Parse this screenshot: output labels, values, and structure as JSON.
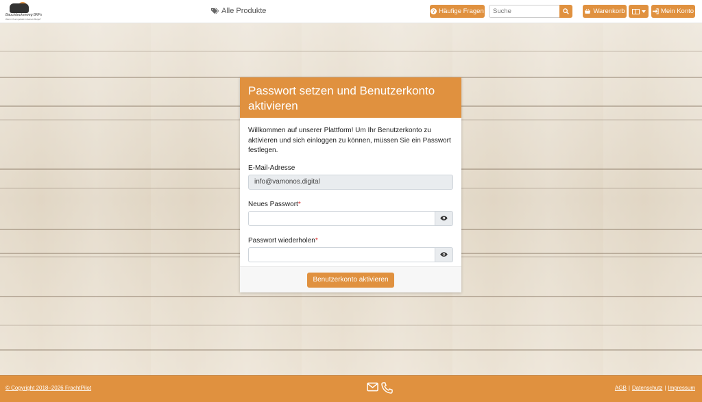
{
  "header": {
    "logo_text": "Bauchdeckenweg BKFs",
    "logo_subtext": "Wenn ich am gehabt in deinem Berge?",
    "nav_products": "Alle Produkte",
    "faq_label": "Häufige Fragen",
    "search_placeholder": "Suche",
    "cart_label": "Warenkorb",
    "account_label": "Mein Konto"
  },
  "card": {
    "title": "Passwort setzen und Benutzerkonto aktivieren",
    "intro": "Willkommen auf unserer Plattform! Um Ihr Benutzerkonto zu aktivieren und sich einloggen zu können, müssen Sie ein Passwort festlegen.",
    "email_label": "E-Mail-Adresse",
    "email_value": "info@vamonos.digital",
    "new_password_label": "Neues Passwort",
    "repeat_password_label": "Passwort wiederholen",
    "required_mark": "*",
    "submit_label": "Benutzerkonto aktivieren"
  },
  "footer": {
    "copyright": "© Copyright 2018–2026 FrachtPilot",
    "agb": "AGB",
    "separator": "|",
    "datenschutz": "Datenschutz",
    "impressum": "Impressum"
  },
  "colors": {
    "accent": "#e0913f"
  },
  "icons": {
    "products": "tag-icon",
    "faq": "question-circle-icon",
    "search": "search-icon",
    "cart": "basket-icon",
    "language": "flag-icon",
    "account": "sign-in-icon",
    "eye": "eye-icon",
    "mail": "envelope-icon",
    "phone": "phone-icon"
  }
}
